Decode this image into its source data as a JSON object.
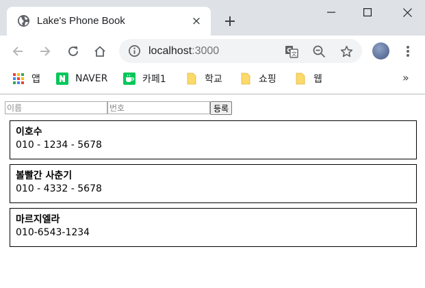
{
  "browser": {
    "tab": {
      "title": "Lake's Phone Book",
      "close_glyph": "×"
    },
    "new_tab_glyph": "+",
    "address": {
      "host": "localhost",
      "port": ":3000"
    },
    "bookmarks": [
      {
        "label": "앱",
        "icon": "apps-grid-icon"
      },
      {
        "label": "NAVER",
        "icon": "naver-icon"
      },
      {
        "label": "카페1",
        "icon": "cafe-icon"
      },
      {
        "label": "학교",
        "icon": "folder-icon"
      },
      {
        "label": "쇼핑",
        "icon": "folder-icon"
      },
      {
        "label": "웹",
        "icon": "folder-icon"
      }
    ],
    "bookmarks_more": "»",
    "colors": {
      "tabstrip": "#dee1e6",
      "omnibox": "#f1f3f4",
      "naver": "#03c75a",
      "folder": "#fbd96a"
    }
  },
  "form": {
    "name_placeholder": "이름",
    "phone_placeholder": "번호",
    "submit_label": "등록"
  },
  "contacts": [
    {
      "name": "이호수",
      "phone": "010 - 1234 - 5678"
    },
    {
      "name": "볼빨간 사춘기",
      "phone": "010 - 4332 - 5678"
    },
    {
      "name": "마르지엘라",
      "phone": "010-6543-1234"
    }
  ]
}
